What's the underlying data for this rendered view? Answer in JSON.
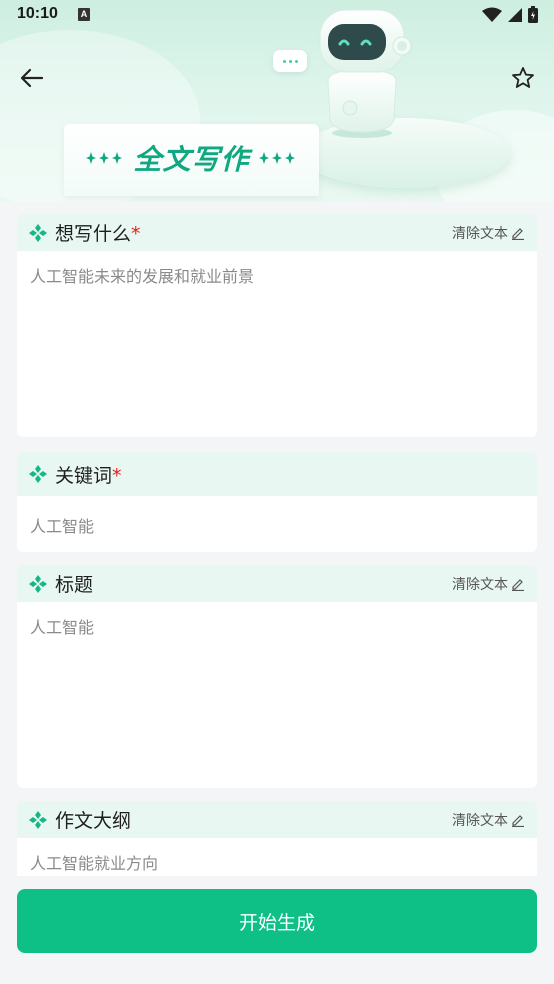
{
  "status": {
    "time": "10:10",
    "notif": "A"
  },
  "header": {
    "title": "全文写作"
  },
  "robot": {
    "bubble": "···"
  },
  "fields": [
    {
      "label": "想写什么",
      "required": "*",
      "clear_label": "清除文本",
      "value": "人工智能未来的发展和就业前景"
    },
    {
      "label": "关键词",
      "required": "*",
      "value": "人工智能"
    },
    {
      "label": "标题",
      "clear_label": "清除文本",
      "value": "人工智能"
    },
    {
      "label": "作文大纲",
      "clear_label": "清除文本",
      "value": "人工智能就业方向"
    }
  ],
  "actions": {
    "generate": "开始生成"
  },
  "colors": {
    "accent": "#0ec086",
    "header_tint": "#e8f7f1",
    "required": "#e02020"
  }
}
